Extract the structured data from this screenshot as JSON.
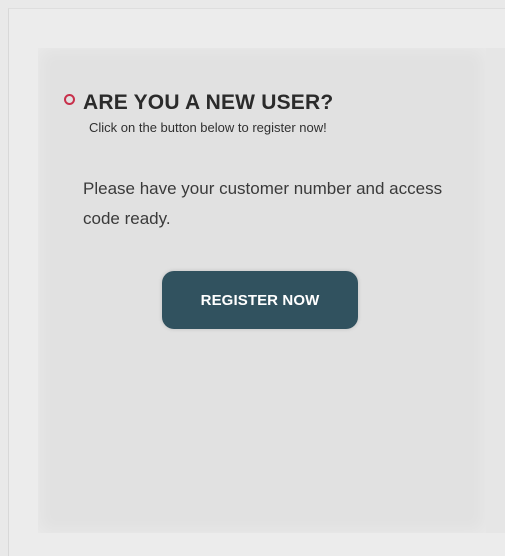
{
  "section": {
    "heading": "ARE YOU A NEW USER?",
    "subheading": "Click on the button below to register now!",
    "body_text": "Please have your customer number and access code ready.",
    "register_button_label": "REGISTER NOW",
    "bullet_icon": "circle-bullet-icon"
  },
  "colors": {
    "accent": "#c8304b",
    "button_background": "#31525f",
    "panel_background": "#e1e1e1"
  }
}
